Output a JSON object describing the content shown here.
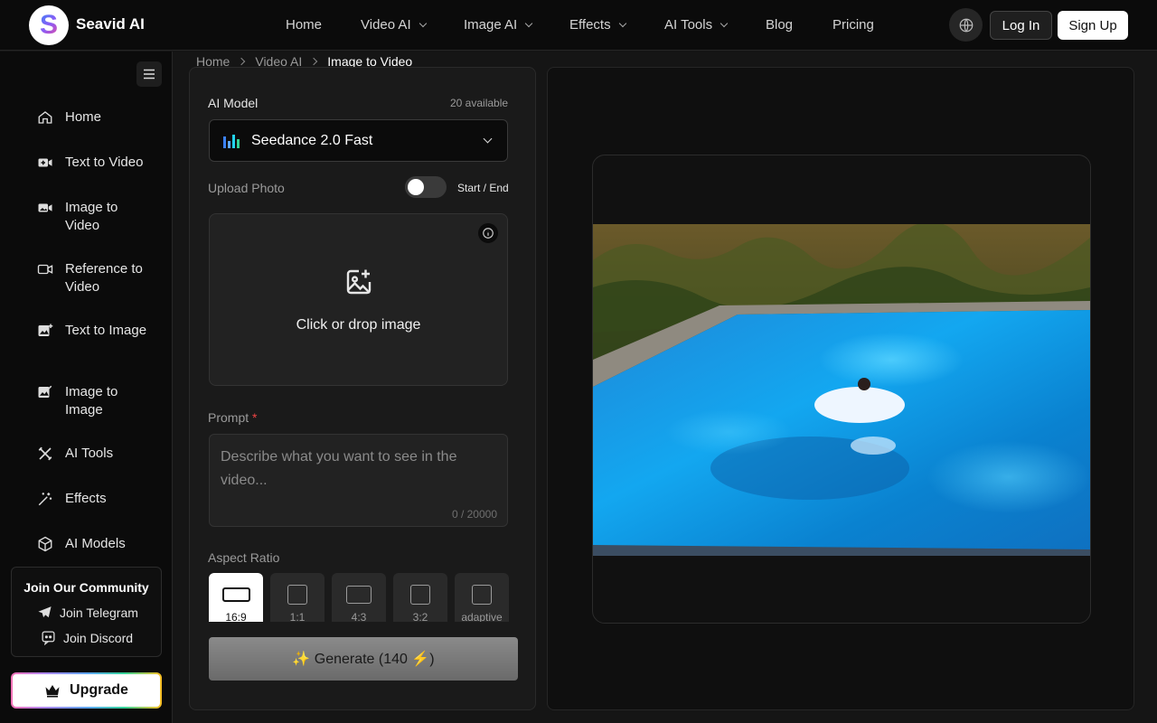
{
  "brand": {
    "logo_letter": "S",
    "name": "Seavid AI"
  },
  "nav": {
    "items": [
      {
        "label": "Home",
        "dropdown": false
      },
      {
        "label": "Video AI",
        "dropdown": true
      },
      {
        "label": "Image AI",
        "dropdown": true
      },
      {
        "label": "Effects",
        "dropdown": true
      },
      {
        "label": "AI Tools",
        "dropdown": true
      },
      {
        "label": "Blog",
        "dropdown": false
      },
      {
        "label": "Pricing",
        "dropdown": false
      }
    ],
    "login": "Log In",
    "signup": "Sign Up",
    "language_icon": "globe-icon"
  },
  "sidebar": {
    "items": [
      {
        "label": "Home",
        "icon": "home-icon"
      },
      {
        "label": "Text to Video",
        "icon": "video-plus-icon"
      },
      {
        "label": "Image to Video",
        "icon": "image-video-icon"
      },
      {
        "label": "Reference to Video",
        "icon": "camera-icon"
      },
      {
        "label": "Text to Image",
        "icon": "image-plus-icon"
      },
      {
        "label": "Image to Image",
        "icon": "image-edit-icon"
      },
      {
        "label": "AI Tools",
        "icon": "tools-icon"
      },
      {
        "label": "Effects",
        "icon": "magic-wand-icon"
      },
      {
        "label": "AI Models",
        "icon": "cube-icon"
      }
    ],
    "community": {
      "title": "Join Our Community",
      "telegram": "Join Telegram",
      "discord": "Join Discord"
    },
    "upgrade": "Upgrade"
  },
  "breadcrumb": [
    "Home",
    "Video AI",
    "Image to Video"
  ],
  "form": {
    "model_label": "AI Model",
    "model_count": "20 available",
    "model_selected": "Seedance 2.0 Fast",
    "upload_label": "Upload Photo",
    "start_end_label": "Start / End",
    "start_end_enabled": false,
    "dropzone_text": "Click or drop image",
    "prompt_label": "Prompt",
    "prompt_required_mark": "*",
    "prompt_value": "",
    "prompt_placeholder": "Describe what you want to see in the video...",
    "prompt_counter": "0 / 20000",
    "aspect_label": "Aspect Ratio",
    "aspect_ratios": [
      "16:9",
      "1:1",
      "4:3",
      "3:2",
      "adaptive"
    ],
    "aspect_selected": "16:9",
    "generate_label": "✨ Generate (140 ⚡)"
  },
  "colors": {
    "accent_pink": "#ec4899",
    "accent_purple": "#8b5cf6",
    "accent_blue": "#3b82f6",
    "required": "#ef4444"
  }
}
